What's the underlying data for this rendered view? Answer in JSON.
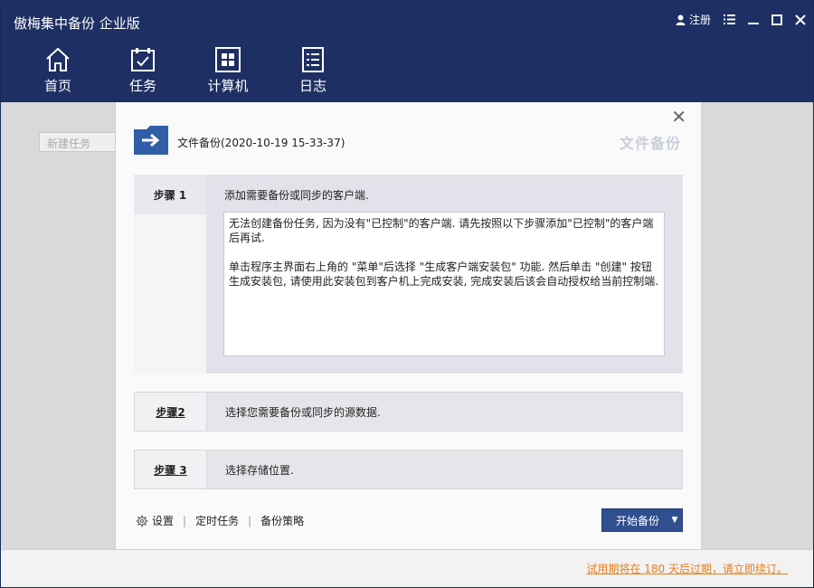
{
  "app": {
    "title": "傲梅集中备份 企业版",
    "register_label": "注册"
  },
  "nav": {
    "items": [
      {
        "label": "首页",
        "icon": "home-icon"
      },
      {
        "label": "任务",
        "icon": "task-icon"
      },
      {
        "label": "计算机",
        "icon": "computer-icon"
      },
      {
        "label": "日志",
        "icon": "log-icon"
      }
    ]
  },
  "sidebar": {
    "new_task_placeholder": "新建任务"
  },
  "dialog": {
    "title": "文件备份(2020-10-19 15-33-37)",
    "type_label": "文件备份",
    "step1": {
      "tab": "步骤 1",
      "desc": "添加需要备份或同步的客户端.",
      "message_p1": "无法创建备份任务, 因为没有\"已控制\"的客户端. 请先按照以下步骤添加\"已控制\"的客户端后再试.",
      "message_p2": "单击程序主界面右上角的 \"菜单\"后选择 \"生成客户端安装包\" 功能. 然后单击 \"创建\" 按钮生成安装包, 请使用此安装包到客户机上完成安装, 完成安装后该会自动授权给当前控制端."
    },
    "step2": {
      "tab": "步骤2",
      "desc": "选择您需要备份或同步的源数据."
    },
    "step3": {
      "tab": "步骤 3",
      "desc": "选择存储位置."
    },
    "footer": {
      "settings": "设置",
      "schedule": "定时任务",
      "strategy": "备份策略",
      "start_button": "开始备份"
    }
  },
  "status": {
    "trial_text": "试用期将在 180 天后过期，请立即续订。"
  },
  "colors": {
    "header_bg": "#1d2f63",
    "button_bg": "#2f4f8f",
    "trial_text": "#e87f1a"
  }
}
